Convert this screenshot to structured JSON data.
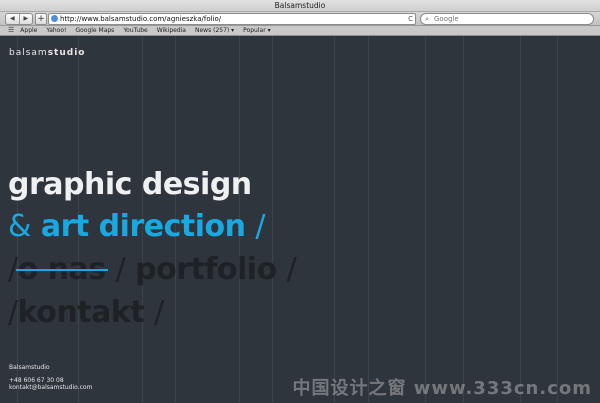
{
  "window": {
    "title": "Balsamstudio"
  },
  "toolbar": {
    "back": "◀",
    "forward": "▶",
    "add": "+",
    "url": "http://www.balsamstudio.com/agnieszka/folio/",
    "reload": "C",
    "search_placeholder": "Google"
  },
  "bookmarks": {
    "items": [
      "Apple",
      "Yahoo!",
      "Google Maps",
      "YouTube",
      "Wikipedia",
      "News (257) ▾",
      "Popular ▾"
    ]
  },
  "page": {
    "logo_light": "balsam",
    "logo_bold": "studio",
    "line1": "graphic design",
    "line2_amp": "&",
    "line2_text": "art direction",
    "slash": "/",
    "nav_onas": "o nas",
    "nav_portfolio": "portfolio",
    "nav_kontakt": "kontakt",
    "footer_name": "Balsamstudio",
    "footer_phone": "+48 606 67 30 08",
    "footer_email": "kontakt@balsamstudio.com",
    "watermark": "中国设计之窗 www.333cn.com"
  },
  "colors": {
    "background": "#2f353c",
    "accent": "#1aa8e3",
    "nav_dark": "#1e2226",
    "text_light": "#eef0f1"
  }
}
